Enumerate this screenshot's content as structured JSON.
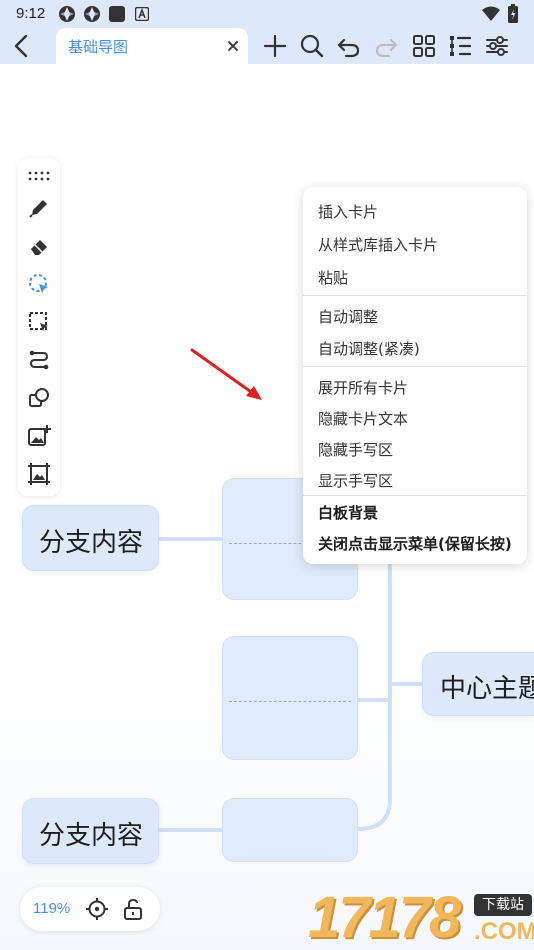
{
  "status_bar": {
    "time": "9:12",
    "icons": [
      "app-icon-1",
      "app-icon-2",
      "square-icon",
      "a-icon",
      "wifi-icon",
      "battery-icon"
    ]
  },
  "toolbar": {
    "tab_title": "基础导图",
    "buttons": [
      "add-icon",
      "search-icon",
      "undo-icon",
      "redo-icon",
      "grid-icon",
      "outline-icon",
      "settings-icon"
    ]
  },
  "mindmap": {
    "branch_top": "分支内容",
    "branch_bottom": "分支内容",
    "center": "中心主题"
  },
  "tool_panel": {
    "tools": [
      "drag-handle-icon",
      "pen-icon",
      "eraser-icon",
      "lasso-select-icon",
      "area-select-icon",
      "connector-icon",
      "shapes-icon",
      "insert-image-icon",
      "image-frame-icon"
    ]
  },
  "context_menu": {
    "items": [
      {
        "label": "插入卡片"
      },
      {
        "label": "从样式库插入卡片"
      },
      {
        "label": "粘贴"
      },
      {
        "label": "自动调整"
      },
      {
        "label": "自动调整(紧凑)"
      },
      {
        "label": "展开所有卡片"
      },
      {
        "label": "隐藏卡片文本"
      },
      {
        "label": "隐藏手写区"
      },
      {
        "label": "显示手写区"
      },
      {
        "label": "白板背景"
      },
      {
        "label": "关闭点击显示菜单(保留长按)"
      }
    ]
  },
  "zoom": {
    "level": "119%"
  },
  "watermark": {
    "digits": "17178",
    "badge": "下载站",
    "suffix": ".COM"
  },
  "colors": {
    "accent": "#4a8fe7",
    "node_fill": "#dde9fa",
    "connector": "#cfe0f6",
    "annotation_arrow": "#e02020"
  }
}
